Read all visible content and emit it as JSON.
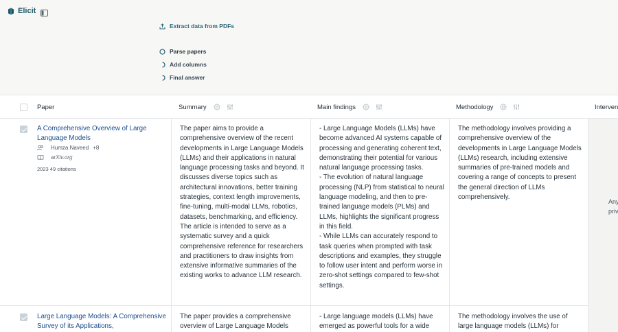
{
  "app": {
    "name": "Elicit"
  },
  "header": {
    "extract_label": "Extract data from PDFs",
    "steps": [
      {
        "label": "Parse papers",
        "state": "in-progress"
      },
      {
        "label": "Add columns",
        "state": "pending"
      },
      {
        "label": "Final answer",
        "state": "pending"
      }
    ]
  },
  "table": {
    "columns": [
      {
        "label": "Paper"
      },
      {
        "label": "Summary"
      },
      {
        "label": "Main findings"
      },
      {
        "label": "Methodology"
      },
      {
        "label": "Interven"
      }
    ],
    "rows": [
      {
        "title": "A Comprehensive Overview of Large Language Models",
        "author": "Humza Naveed",
        "more_authors": "+8",
        "source": "arXiv.org",
        "citation": "2023 49 citations",
        "summary": "The paper aims to provide a comprehensive overview of the recent developments in Large Language Models (LLMs) and their applications in natural language processing tasks and beyond. It discusses diverse topics such as architectural innovations, better training strategies, context length improvements, fine-tuning, multi-modal LLMs, robotics, datasets, benchmarking, and efficiency. The article is intended to serve as a systematic survey and a quick comprehensive reference for researchers and practitioners to draw insights from extensive informative summaries of the existing works to advance LLM research.",
        "findings": "- Large Language Models (LLMs) have become advanced AI systems capable of processing and generating coherent text, demonstrating their potential for various natural language processing tasks.\n- The evolution of natural language processing (NLP) from statistical to neural language modeling, and then to pre-trained language models (PLMs) and LLMs, highlights the significant progress in this field.\n- While LLMs can accurately respond to task queries when prompted with task descriptions and examples, they struggle to follow user intent and perform worse in zero-shot settings compared to few-shot settings.",
        "methodology": "The methodology involves providing a comprehensive overview of the developments in Large Language Models (LLMs) research, including extensive summaries of pre-trained models and covering a range of concepts to present the general direction of LLMs comprehensively.",
        "intervention_partial": "Any\nprivat"
      },
      {
        "title": "Large Language Models: A Comprehensive Survey of its Applications,",
        "summary": "The paper provides a comprehensive overview of Large Language Models",
        "findings": "- Large language models (LLMs) have emerged as powerful tools for a wide",
        "methodology": "The methodology involves the use of large language models (LLMs) for"
      }
    ]
  },
  "colors": {
    "accent": "#1c5a68",
    "link": "#1a4d8c",
    "background": "#f7f7f5",
    "border": "#e3e6e8"
  }
}
